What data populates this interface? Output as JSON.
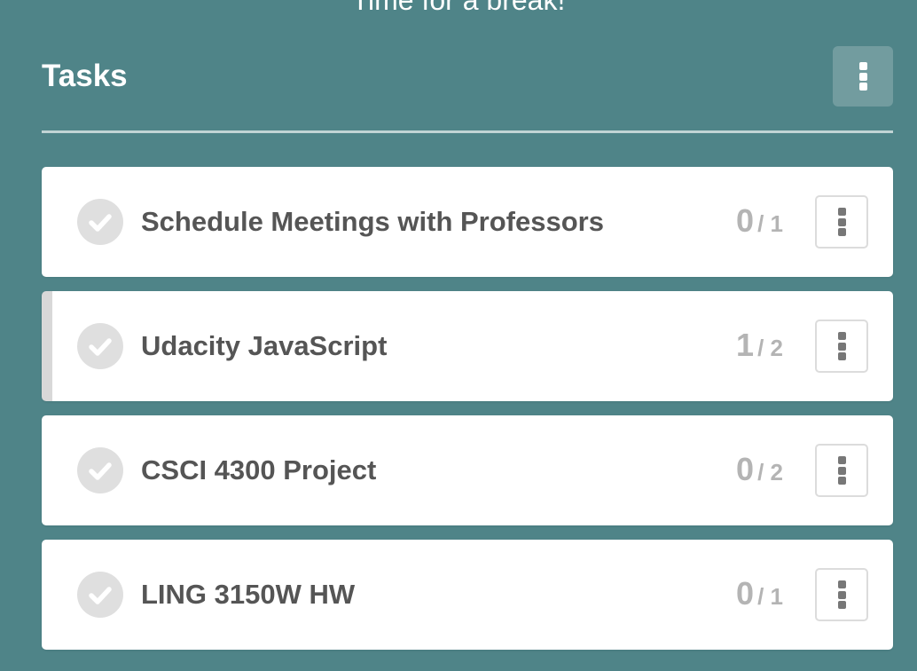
{
  "top_message": "Time for a break!",
  "header": {
    "title": "Tasks"
  },
  "colors": {
    "background": "#4f8488",
    "card": "#ffffff",
    "task_text": "#555555",
    "count_text": "#b4b4b4",
    "check_circle": "#dfdfdf",
    "active_marker": "#d8d8d8"
  },
  "icons": {
    "header_menu": "kebab-icon",
    "task_check": "checkmark-icon",
    "task_menu": "kebab-icon"
  },
  "tasks": [
    {
      "title": "Schedule Meetings with Professors",
      "done": "0",
      "total": "/ 1",
      "active": false
    },
    {
      "title": "Udacity JavaScript",
      "done": "1",
      "total": "/ 2",
      "active": true
    },
    {
      "title": "CSCI 4300 Project",
      "done": "0",
      "total": "/ 2",
      "active": false
    },
    {
      "title": "LING 3150W HW",
      "done": "0",
      "total": "/ 1",
      "active": false
    }
  ]
}
